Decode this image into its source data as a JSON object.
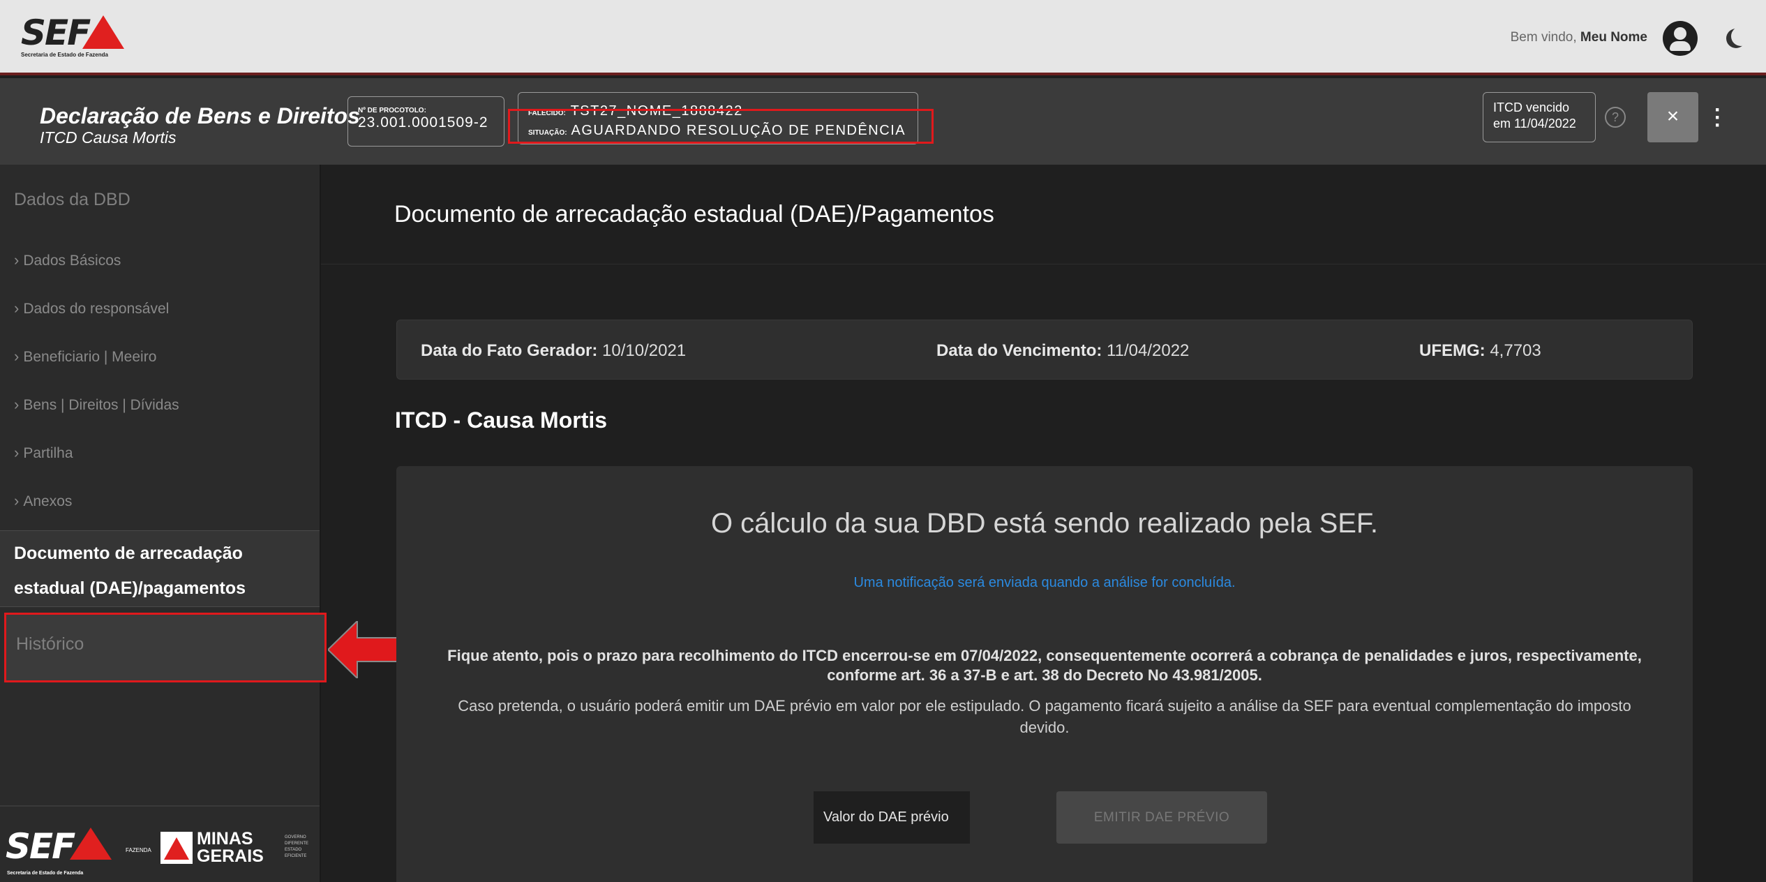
{
  "brand": {
    "logo_text": "SEF",
    "logo_sub": "Secretaria de Estado de Fazenda",
    "footer_fazenda": "FAZENDA",
    "footer_mg_line1": "MINAS",
    "footer_mg_line2": "GERAIS",
    "footer_gov": "GOVERNO DIFERENTE ESTADO EFICIENTE"
  },
  "topbar": {
    "welcome_prefix": "Bem vindo, ",
    "user_name": "Meu Nome"
  },
  "header": {
    "title": "Declaração de Bens e Direitos",
    "subtitle": "ITCD Causa Mortis",
    "protocol_label": "Nº DE PROCOTOLO:",
    "protocol_value": "23.001.0001509-2",
    "falecido_label": "FALECIDO:",
    "falecido_value": "TST27_NOME_1888422",
    "situacao_label": "SITUAÇÃO:",
    "situacao_value": "AGUARDANDO RESOLUÇÃO DE PENDÊNCIA",
    "vencido_line1": "ITCD vencido",
    "vencido_line2": "em 11/04/2022",
    "close_label": "×",
    "help_label": "?"
  },
  "sidebar": {
    "heading": "Dados da DBD",
    "items": [
      {
        "label": "Dados Básicos"
      },
      {
        "label": "Dados do responsável"
      },
      {
        "label": "Beneficiario | Meeiro"
      },
      {
        "label": "Bens | Direitos | Dívidas"
      },
      {
        "label": "Partilha"
      },
      {
        "label": "Anexos"
      }
    ],
    "active_line1": "Documento de arrecadação",
    "active_line2": "estadual (DAE)/pagamentos",
    "historico": "Histórico"
  },
  "main": {
    "page_title": "Documento de arrecadação estadual (DAE)/Pagamentos",
    "fato_label": "Data do Fato Gerador:",
    "fato_value": "10/10/2021",
    "venc_label": "Data do Vencimento:",
    "venc_value": "11/04/2022",
    "ufemg_label": "UFEMG:",
    "ufemg_value": "4,7703",
    "section_title": "ITCD - Causa Mortis",
    "calc_title": "O cálculo da sua DBD está sendo realizado pela SEF.",
    "calc_note": "Uma notificação será enviada quando a análise for concluída.",
    "warn_line1": "Fique atento, pois o prazo para recolhimento do ITCD encerrou-se em 07/04/2022, consequentemente ocorrerá a cobrança de penalidades e juros, respectivamente,",
    "warn_line2": "conforme art. 36 a 37-B e art. 38 do Decreto No 43.981/2005.",
    "info_line1": "Caso pretenda, o usuário poderá emitir um DAE prévio em valor por ele estipulado. O pagamento ficará sujeito a análise da SEF para eventual complementação do imposto",
    "info_line2": "devido.",
    "dae_placeholder": "Valor do DAE prévio",
    "emit_button": "EMITIR DAE PRÉVIO"
  },
  "colors": {
    "accent_red": "#e0191c",
    "link_blue": "#2b8ae0",
    "bg_dark": "#1f1f1f"
  }
}
